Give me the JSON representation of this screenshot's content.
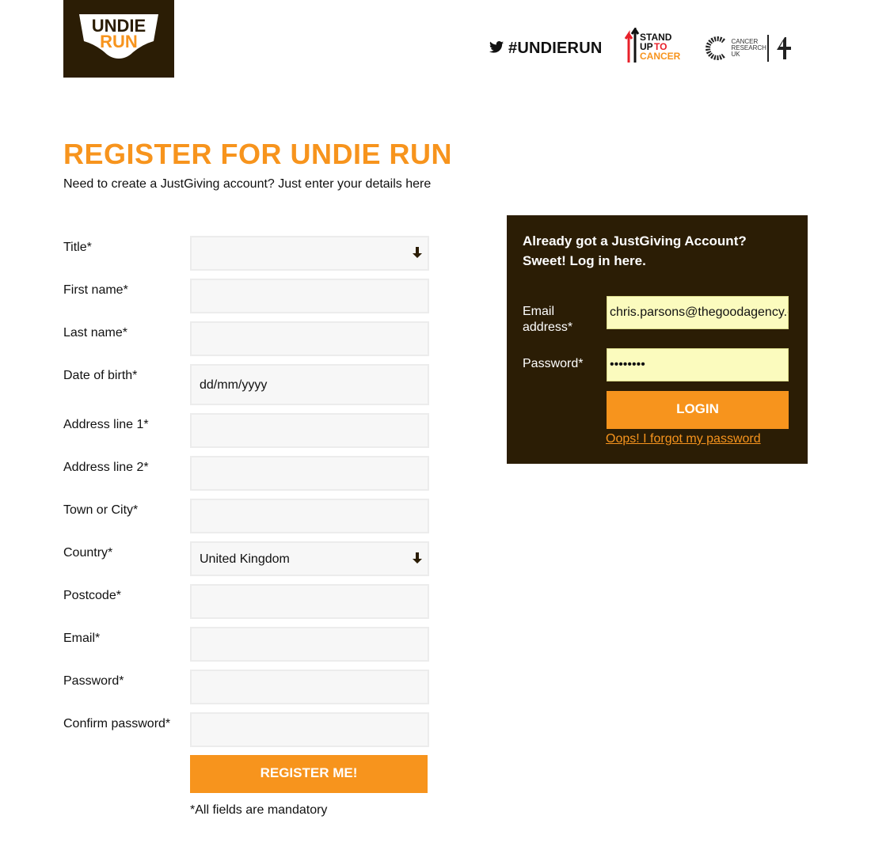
{
  "brand": {
    "logo_line1": "UNDIE",
    "logo_line2": "RUN",
    "hashtag": "#UNDIERUN",
    "su2c_line1": "STAND",
    "su2c_line2": "UP",
    "su2c_line2b": "TO",
    "su2c_line3": "CANCER",
    "cruk_text": "CANCER RESEARCH UK",
    "accent_color": "#f7941d",
    "dark_color": "#2b1d05"
  },
  "register": {
    "title": "REGISTER FOR UNDIE RUN",
    "intro": "Need to create a JustGiving account? Just enter your details here",
    "fields": [
      {
        "label": "Title*",
        "type": "select",
        "value": ""
      },
      {
        "label": "First name*",
        "type": "text",
        "value": ""
      },
      {
        "label": "Last name*",
        "type": "text",
        "value": ""
      },
      {
        "label": "Date of birth*",
        "type": "text",
        "value": "dd/mm/yyyy"
      },
      {
        "label": "Address line 1*",
        "type": "text",
        "value": ""
      },
      {
        "label": "Address line 2*",
        "type": "text",
        "value": ""
      },
      {
        "label": "Town or City*",
        "type": "text",
        "value": ""
      },
      {
        "label": "Country*",
        "type": "select",
        "value": "United Kingdom"
      },
      {
        "label": "Postcode*",
        "type": "text",
        "value": ""
      },
      {
        "label": "Email*",
        "type": "text",
        "value": ""
      },
      {
        "label": "Password*",
        "type": "text",
        "value": ""
      },
      {
        "label": "Confirm password*",
        "type": "text",
        "value": ""
      }
    ],
    "submit_label": "REGISTER ME!",
    "mandatory_note": "*All fields are mandatory"
  },
  "login": {
    "title_line1": "Already got a JustGiving Account?",
    "title_line2": "Sweet! Log in here.",
    "email_label": "Email address*",
    "email_value": "chris.parsons@thegoodagency.co.uk",
    "password_label": "Password*",
    "password_value": "••••••••",
    "login_label": "LOGIN",
    "forgot_label": "Oops! I forgot my password"
  }
}
